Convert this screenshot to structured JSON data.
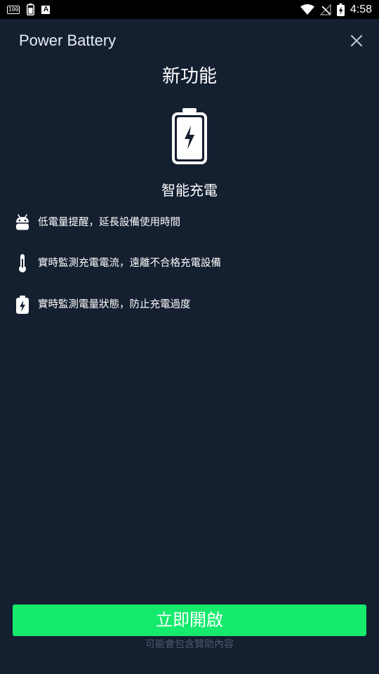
{
  "status_bar": {
    "badge_100": "100",
    "badge_a": "A",
    "time": "4:58"
  },
  "header": {
    "app_title": "Power Battery"
  },
  "feature": {
    "title": "新功能",
    "subtitle": "智能充電",
    "items": [
      {
        "icon": "android-icon",
        "text": "低電量提醒，延長設備使用時間"
      },
      {
        "icon": "thermometer-icon",
        "text": "實時監測充電電流，遠離不合格充電設備"
      },
      {
        "icon": "battery-charging-icon",
        "text": "實時監測電量狀態，防止充電過度"
      }
    ]
  },
  "actions": {
    "enable_label": "立即開啟",
    "sponsor_note": "可能會包含贊助內容"
  },
  "colors": {
    "background": "#141f30",
    "accent": "#16ea6c",
    "muted_text": "#4d5a6b"
  }
}
